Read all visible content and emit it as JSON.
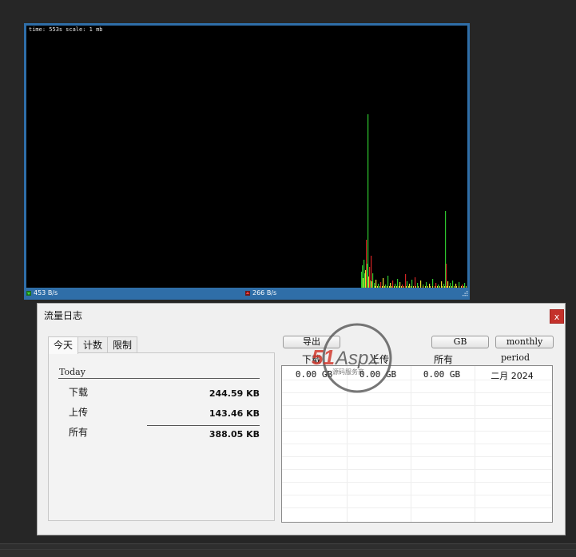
{
  "graph": {
    "time_label": "time: 553s",
    "scale_label": "scale: 1 mb",
    "download_rate": "453 B/s",
    "upload_rate": "266 B/s",
    "colors": {
      "download": "#2ec62e",
      "upload": "#d42424",
      "overlap": "#e8e030"
    }
  },
  "log_window": {
    "title": "流量日志",
    "close_label": "x",
    "tabs": [
      "今天",
      "计数",
      "限制"
    ],
    "today": {
      "heading": "Today",
      "download_label": "下载",
      "download_value": "244.59 KB",
      "upload_label": "上传",
      "upload_value": "143.46 KB",
      "total_label": "所有",
      "total_value": "388.05 KB"
    },
    "buttons": {
      "export": "导出",
      "unit": "GB",
      "period": "monthly"
    },
    "columns": [
      "下载",
      "上传",
      "所有",
      "period"
    ],
    "rows": [
      [
        "0.00 GB",
        "0.00 GB",
        "0.00 GB",
        "二月 2024"
      ]
    ]
  },
  "watermark": {
    "brand": "51Aspx",
    "tagline": "源码服务商"
  }
}
